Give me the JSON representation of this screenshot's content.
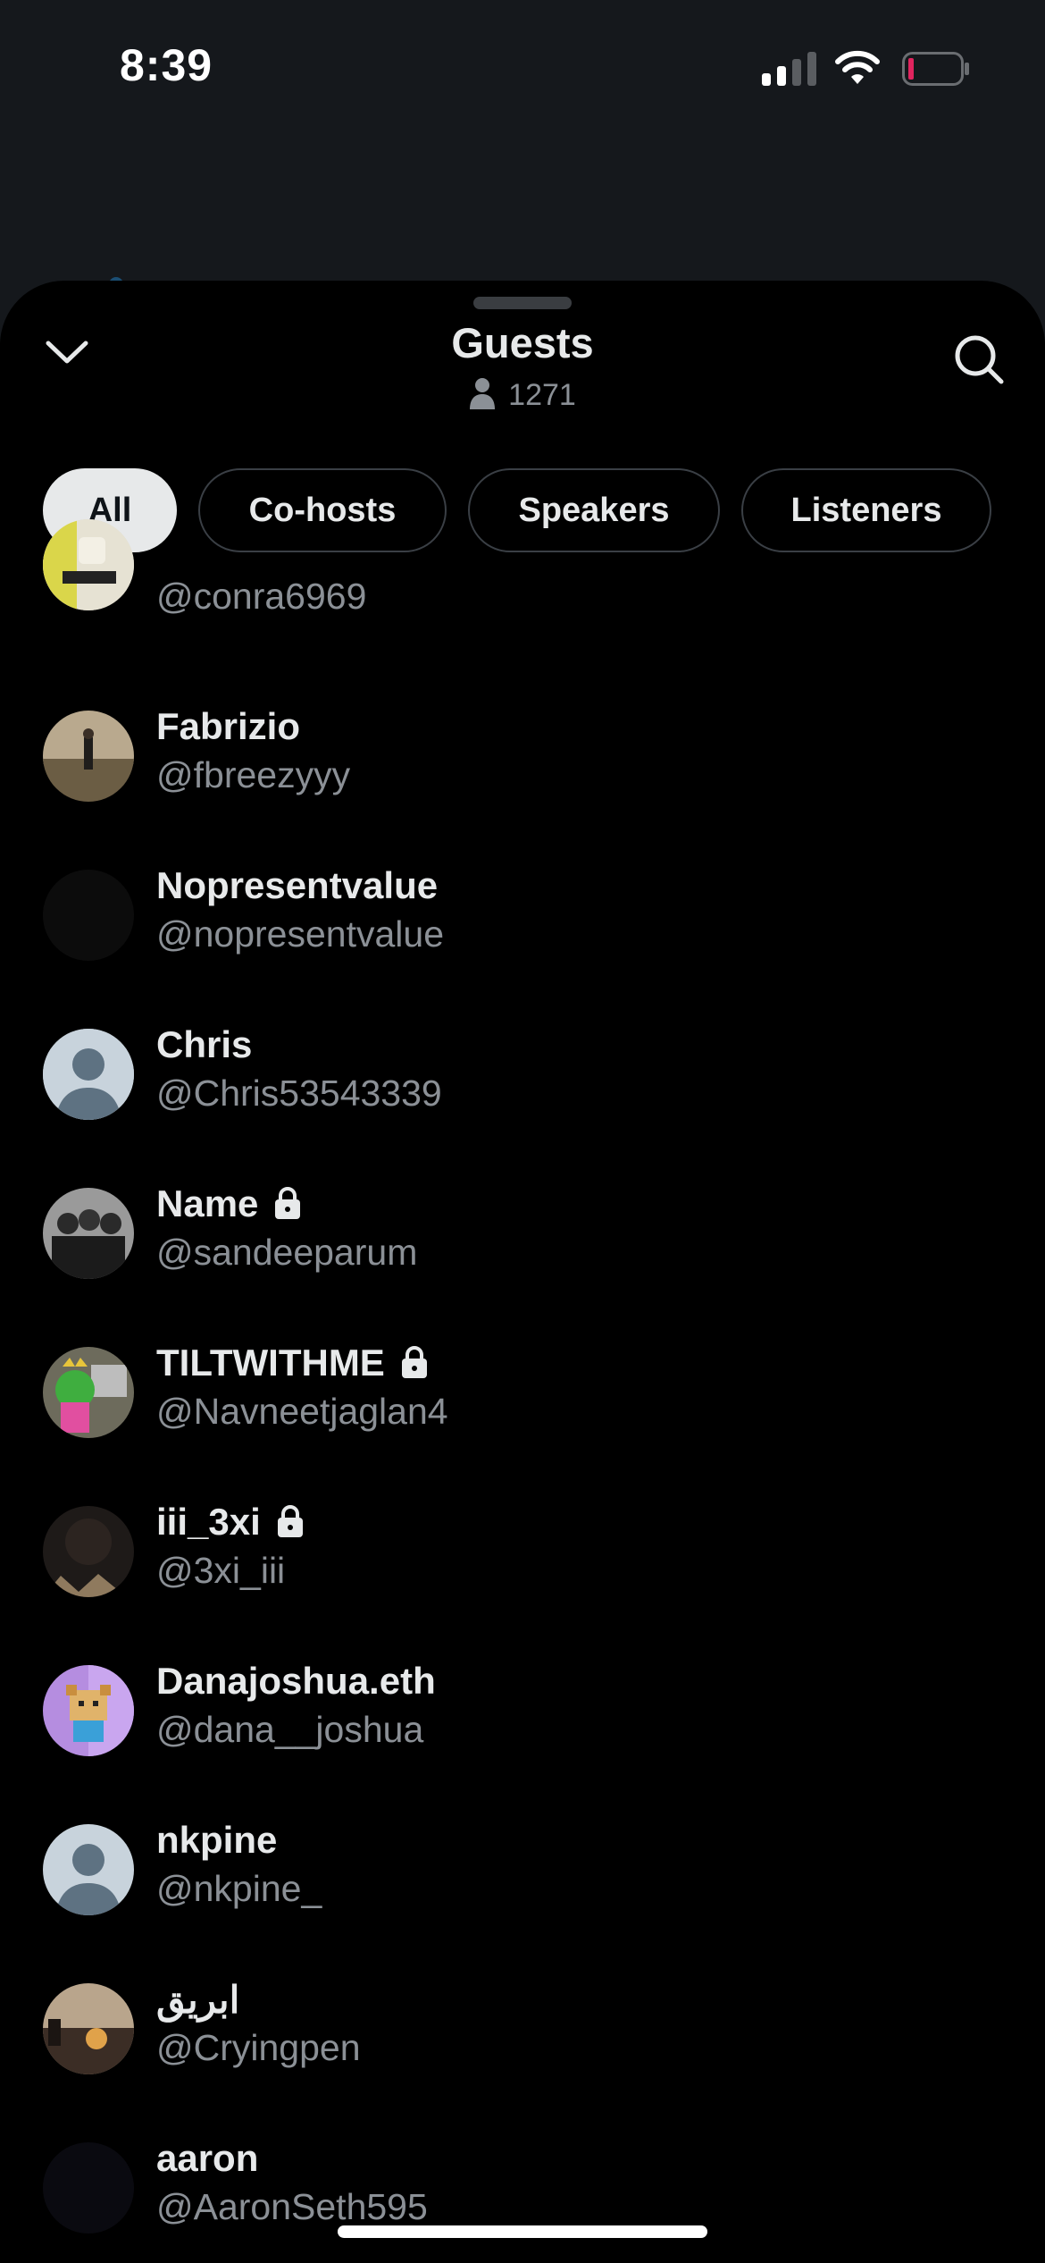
{
  "status_bar": {
    "time": "8:39"
  },
  "sheet": {
    "title": "Guests",
    "listener_count": "1271",
    "tabs": [
      {
        "label": "All",
        "active": true
      },
      {
        "label": "Co-hosts",
        "active": false
      },
      {
        "label": "Speakers",
        "active": false
      },
      {
        "label": "Listeners",
        "active": false
      }
    ]
  },
  "guests": [
    {
      "name": "",
      "handle": "@conra6969",
      "locked": false,
      "avatar": "gucci-shirt-photo"
    },
    {
      "name": "Fabrizio",
      "handle": "@fbreezyyy",
      "locked": false,
      "avatar": "landscape-photo"
    },
    {
      "name": "Nopresentvalue",
      "handle": "@nopresentvalue",
      "locked": false,
      "avatar": "dark-photo"
    },
    {
      "name": "Chris",
      "handle": "@Chris53543339",
      "locked": false,
      "avatar": "default-avatar"
    },
    {
      "name": "Name",
      "handle": "@sandeeparum",
      "locked": true,
      "avatar": "group-photo-bw"
    },
    {
      "name": "TILTWITHME",
      "handle": "@Navneetjaglan4",
      "locked": true,
      "avatar": "pepe-art"
    },
    {
      "name": "iii_3xi",
      "handle": "@3xi_iii",
      "locked": true,
      "avatar": "dark-photo-hair"
    },
    {
      "name": "Danajoshua.eth",
      "handle": "@dana__joshua",
      "locked": false,
      "avatar": "pixel-bear-purple"
    },
    {
      "name": "nkpine",
      "handle": "@nkpine_",
      "locked": false,
      "avatar": "default-avatar"
    },
    {
      "name": "ابريق",
      "handle": "@Cryingpen",
      "locked": false,
      "avatar": "sunset-photo"
    },
    {
      "name": "aaron",
      "handle": "@AaronSeth595",
      "locked": false,
      "avatar": "dark-photo"
    }
  ],
  "colors": {
    "sheet_bg": "#000000",
    "backdrop": "#15181c",
    "primary_text": "#e7e9ea",
    "secondary_text": "#8b9096",
    "battery_low": "#e0245e"
  }
}
